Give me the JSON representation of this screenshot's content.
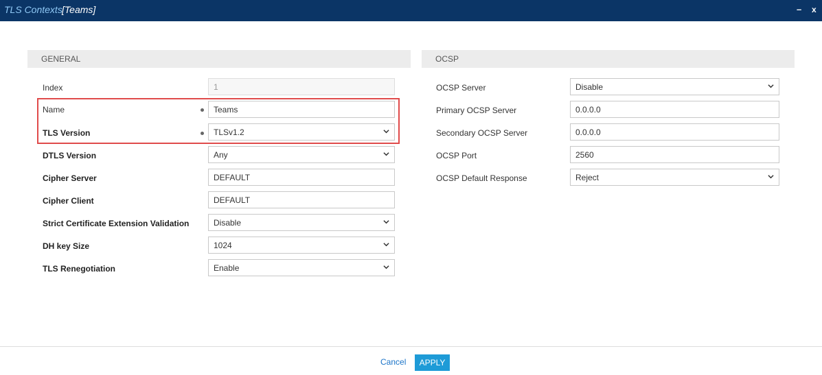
{
  "titlebar": {
    "title": "TLS Contexts",
    "subtitle": "[Teams]",
    "minimize": "–",
    "close": "x"
  },
  "general": {
    "header": "GENERAL",
    "rows": [
      {
        "label": "Index",
        "value": "1"
      },
      {
        "label": "Name",
        "value": "Teams"
      },
      {
        "label": "TLS Version",
        "value": "TLSv1.2"
      },
      {
        "label": "DTLS Version",
        "value": "Any"
      },
      {
        "label": "Cipher Server",
        "value": "DEFAULT"
      },
      {
        "label": "Cipher Client",
        "value": "DEFAULT"
      },
      {
        "label": "Strict Certificate Extension Validation",
        "value": "Disable"
      },
      {
        "label": "DH key Size",
        "value": "1024"
      },
      {
        "label": "TLS Renegotiation",
        "value": "Enable"
      }
    ]
  },
  "ocsp": {
    "header": "OCSP",
    "rows": [
      {
        "label": "OCSP Server",
        "value": "Disable"
      },
      {
        "label": "Primary OCSP Server",
        "value": "0.0.0.0"
      },
      {
        "label": "Secondary OCSP Server",
        "value": "0.0.0.0"
      },
      {
        "label": "OCSP Port",
        "value": "2560"
      },
      {
        "label": "OCSP Default Response",
        "value": "Reject"
      }
    ]
  },
  "footer": {
    "cancel": "Cancel",
    "apply": "APPLY"
  },
  "colors": {
    "titlebar": "#0b3566",
    "accent": "#1e9bd7",
    "highlight": "#e04a4a"
  }
}
